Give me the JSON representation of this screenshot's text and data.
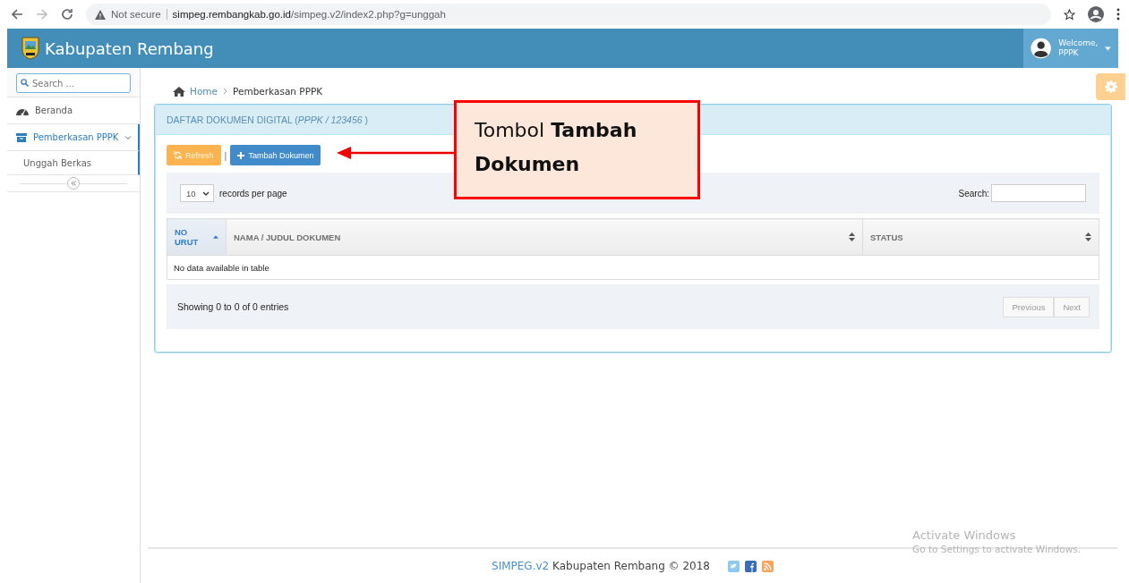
{
  "browser": {
    "security": "Not secure",
    "url_host": "simpeg.rembangkab.go.id",
    "url_path": "/simpeg.v2/index2.php?g=unggah"
  },
  "header": {
    "brand": "Kabupaten Rembang",
    "welcome": "Welcome,",
    "user": "PPPK"
  },
  "sidebar": {
    "search_placeholder": "Search ...",
    "items": [
      {
        "label": "Beranda",
        "kind": "link",
        "selected": false
      },
      {
        "label": "Pemberkasan PPPK",
        "kind": "group",
        "selected": true,
        "expanded": true,
        "children": [
          {
            "label": "Unggah Berkas",
            "selected": false
          }
        ]
      }
    ]
  },
  "breadcrumb": [
    "Home",
    "Pemberkasan PPPK"
  ],
  "panel": {
    "title": "DAFTAR DOKUMEN DIGITAL (*PPPK / 123456* )",
    "buttons": [
      {
        "label": "Refresh",
        "kind": "warning"
      },
      {
        "label": "Tambah Dokumen",
        "kind": "primary"
      }
    ],
    "separator": "|",
    "length": {
      "value": "10",
      "label": "records per page"
    },
    "search_label": "Search:",
    "columns": [
      {
        "label": "NO URUT",
        "sorted": true
      },
      {
        "label": "NAMA / JUDUL DOKUMEN",
        "sorted": false
      },
      {
        "label": "STATUS",
        "sorted": false
      }
    ],
    "empty": "No data available in table",
    "info": "Showing 0 to 0 of 0 entries",
    "pager": [
      {
        "label": "Previous",
        "disabled": true
      },
      {
        "label": "Next",
        "disabled": true
      }
    ]
  },
  "footer": {
    "brand": "SIMPEG.v2",
    "text": "Kabupaten Rembang © 2018"
  },
  "annotation": {
    "text": "Tombol **Tambah Dokumen**"
  },
  "os_notice": {
    "title": "Activate Windows",
    "text": "Go to Settings to activate Windows."
  }
}
